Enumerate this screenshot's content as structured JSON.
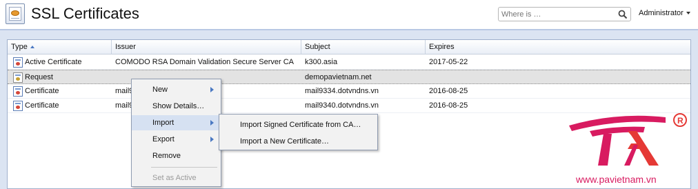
{
  "header": {
    "title": "SSL Certificates",
    "search_placeholder": "Where is …",
    "user_menu_label": "Administrator"
  },
  "icons": {
    "app": "certificate-icon",
    "search": "search-icon",
    "user_caret": "chevron-down-icon",
    "cert": "certificate-icon",
    "request": "certificate-request-icon",
    "submenu": "chevron-right-icon"
  },
  "table": {
    "columns": [
      "Type",
      "Issuer",
      "Subject",
      "Expires"
    ],
    "sorted_column": "Type",
    "rows": [
      {
        "type": "Active Certificate",
        "issuer": "COMODO RSA Domain Validation Secure Server CA",
        "subject": "k300.asia",
        "expires": "2017-05-22"
      },
      {
        "type": "Request",
        "issuer": "",
        "subject": "demopavietnam.net",
        "expires": ""
      },
      {
        "type": "Certificate",
        "issuer": "mail9",
        "subject": "mail9334.dotvndns.vn",
        "expires": "2016-08-25"
      },
      {
        "type": "Certificate",
        "issuer": "mail9",
        "subject": "mail9340.dotvndns.vn",
        "expires": "2016-08-25"
      }
    ]
  },
  "context_menu": {
    "items": [
      "New",
      "Show Details…",
      "Import",
      "Export",
      "Remove",
      "Set as Active"
    ]
  },
  "import_submenu": {
    "items": [
      "Import Signed Certificate from CA…",
      "Import a New Certificate…"
    ]
  },
  "watermark": {
    "text": "www.pavietnam.vn",
    "colors": {
      "magenta": "#d81b60",
      "red": "#e53935"
    }
  },
  "colors": {
    "accent": "#4a78c2",
    "panel_bg": "#dbe4f2",
    "menu_hover": "#d6e1f2"
  }
}
